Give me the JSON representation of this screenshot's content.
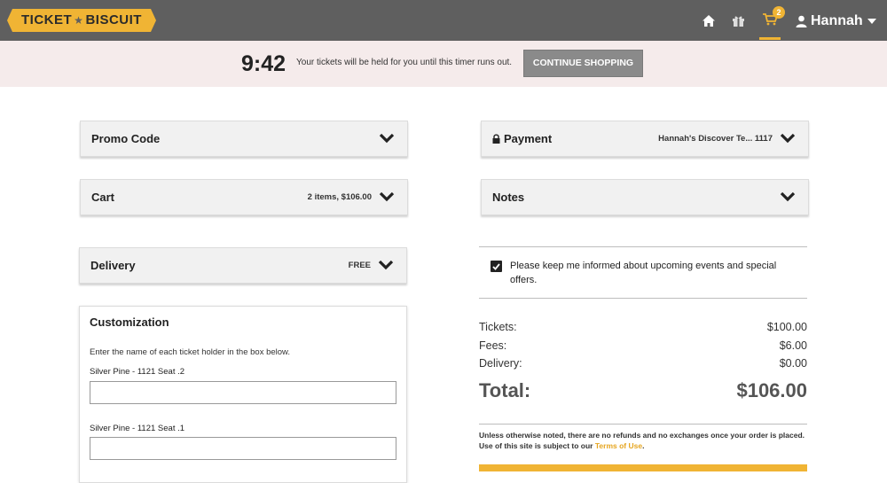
{
  "header": {
    "logo_left": "TICKET",
    "logo_star": "★",
    "logo_right": "BISCUIT",
    "cart_count": "2",
    "user_name": "Hannah",
    "icons": [
      "home-icon",
      "gift-icon",
      "cart-icon",
      "user-icon",
      "caret-down-icon"
    ],
    "accent_color": "#f0b434"
  },
  "timer_bar": {
    "time": "9:42",
    "message": "Your tickets will be held for you until this timer runs out.",
    "button_label": "CONTINUE SHOPPING"
  },
  "left": {
    "promo": {
      "title": "Promo Code"
    },
    "cart": {
      "title": "Cart",
      "meta": "2 items, $106.00"
    },
    "delivery": {
      "title": "Delivery",
      "meta": "FREE"
    },
    "customization": {
      "title": "Customization",
      "instructions": "Enter the name of each ticket holder in the box below.",
      "holders": [
        {
          "label": "Silver Pine - 1121 Seat .2",
          "value": ""
        },
        {
          "label": "Silver Pine - 1121 Seat .1",
          "value": ""
        }
      ]
    }
  },
  "right": {
    "payment": {
      "title": "Payment",
      "meta": "Hannah's Discover Te... 1117"
    },
    "notes": {
      "title": "Notes"
    },
    "opt_in": {
      "checked": true,
      "text": "Please keep me informed about upcoming events and special offers."
    },
    "summary": {
      "tickets_label": "Tickets:",
      "tickets_value": "$100.00",
      "fees_label": "Fees:",
      "fees_value": "$6.00",
      "delivery_label": "Delivery:",
      "delivery_value": "$0.00",
      "total_label": "Total:",
      "total_value": "$106.00"
    },
    "policy": {
      "text": "Unless otherwise noted, there are no refunds and no exchanges once your order is placed. Use of this site is subject to our ",
      "link": "Terms of Use",
      "end": "."
    }
  }
}
